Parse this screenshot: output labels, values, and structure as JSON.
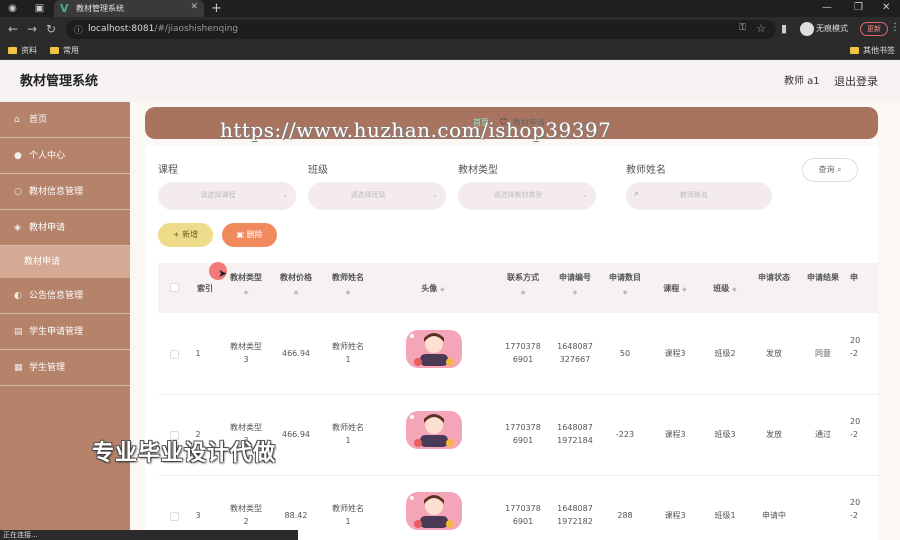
{
  "browser": {
    "tab_title": "教材管理系统",
    "url_host": "localhost:8081",
    "url_path": "/#/jiaoshishenqing",
    "incognito_label": "无痕模式",
    "update_label": "更新",
    "bookmarks": [
      "资料",
      "常用"
    ],
    "bookmarks_other": "其他书签",
    "status_text": "正在连接..."
  },
  "header": {
    "title": "教材管理系统",
    "user": "教师 a1",
    "logout": "退出登录"
  },
  "sidebar": {
    "items": [
      {
        "label": "首页",
        "icon": "home-icon"
      },
      {
        "label": "个人中心",
        "icon": "user-icon"
      },
      {
        "label": "教材信息管理",
        "icon": "book-icon"
      },
      {
        "label": "教材申请",
        "icon": "apply-icon"
      },
      {
        "label": "公告信息管理",
        "icon": "notice-icon"
      },
      {
        "label": "学生申请管理",
        "icon": "student-apply-icon"
      },
      {
        "label": "学生管理",
        "icon": "student-icon"
      }
    ],
    "active_sub": "教材申请"
  },
  "breadcrumb": {
    "home": "首页",
    "current": "教材申请"
  },
  "watermarks": {
    "url": "https://www.huzhan.com/ishop39397",
    "cn": "专业毕业设计代做"
  },
  "filters": {
    "course_label": "课程",
    "course_placeholder": "请选择课程",
    "class_label": "班级",
    "class_placeholder": "请选择班级",
    "type_label": "教材类型",
    "type_placeholder": "请选择教材类型",
    "teacher_label": "教师姓名",
    "teacher_placeholder": "教师姓名",
    "query_button": "查询"
  },
  "actions": {
    "add": "新增",
    "delete": "删除"
  },
  "table": {
    "headers": [
      "索引",
      "教材类型",
      "教材价格",
      "教师姓名",
      "头像",
      "联系方式",
      "申请编号",
      "申请数目",
      "课程",
      "班级",
      "申请状态",
      "申请结果",
      "申"
    ],
    "rows": [
      {
        "index": "1",
        "type": [
          "教材类型",
          "3"
        ],
        "price": "466.94",
        "teacher": [
          "教师姓名",
          "1"
        ],
        "phone": [
          "1770378",
          "6901"
        ],
        "apply_no": [
          "1648087",
          "327667"
        ],
        "count": "50",
        "course": "课程3",
        "class": "班级2",
        "status": "发放",
        "result": "同意",
        "date": [
          "20",
          "-2"
        ]
      },
      {
        "index": "2",
        "type": [
          "教材类型",
          "3"
        ],
        "price": "466.94",
        "teacher": [
          "教师姓名",
          "1"
        ],
        "phone": [
          "1770378",
          "6901"
        ],
        "apply_no": [
          "1648087",
          "1972184"
        ],
        "count": "-223",
        "course": "课程3",
        "class": "班级3",
        "status": "发放",
        "result": "通过",
        "date": [
          "20",
          "-2"
        ]
      },
      {
        "index": "3",
        "type": [
          "教材类型",
          "2"
        ],
        "price": "88.42",
        "teacher": [
          "教师姓名",
          "1"
        ],
        "phone": [
          "1770378",
          "6901"
        ],
        "apply_no": [
          "1648087",
          "1972182"
        ],
        "count": "288",
        "course": "课程3",
        "class": "班级1",
        "status": "申请中",
        "result": "",
        "date": [
          "20",
          "-2"
        ]
      }
    ]
  }
}
